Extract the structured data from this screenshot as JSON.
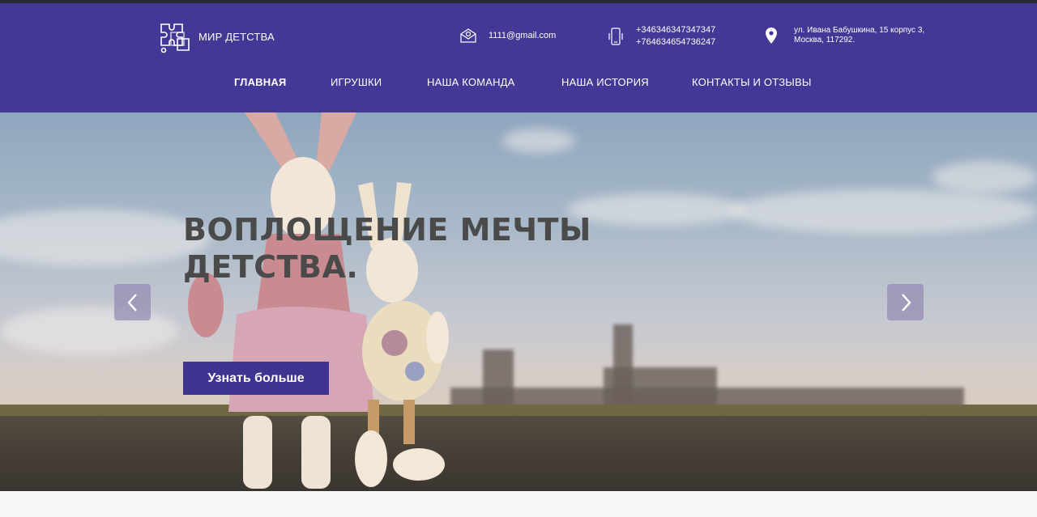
{
  "brand": {
    "name": "МИР ДЕТСТВА",
    "logo_icon": "puzzle-icon"
  },
  "contacts": {
    "email": "1111@gmail.com",
    "phone1": "+346346347347347",
    "phone2": "+764634654736247",
    "address_line1": "ул. Ивана Бабушкина, 15 корпус 3,",
    "address_line2": "Москва, 117292."
  },
  "nav": {
    "items": [
      {
        "label": "ГЛАВНАЯ",
        "active": true
      },
      {
        "label": "ИГРУШКИ"
      },
      {
        "label": "НАША КОМАНДА"
      },
      {
        "label": "НАША ИСТОРИЯ"
      },
      {
        "label": "КОНТАКТЫ И ОТЗЫВЫ"
      }
    ]
  },
  "hero": {
    "title_line1": "ВОПЛОЩЕНИЕ МЕЧТЫ",
    "title_line2": "ДЕТСТВА.",
    "cta_label": "Узнать больше"
  },
  "colors": {
    "header_bg": "#433895",
    "cta_bg": "#3f348f",
    "title": "#4a4a4a"
  }
}
